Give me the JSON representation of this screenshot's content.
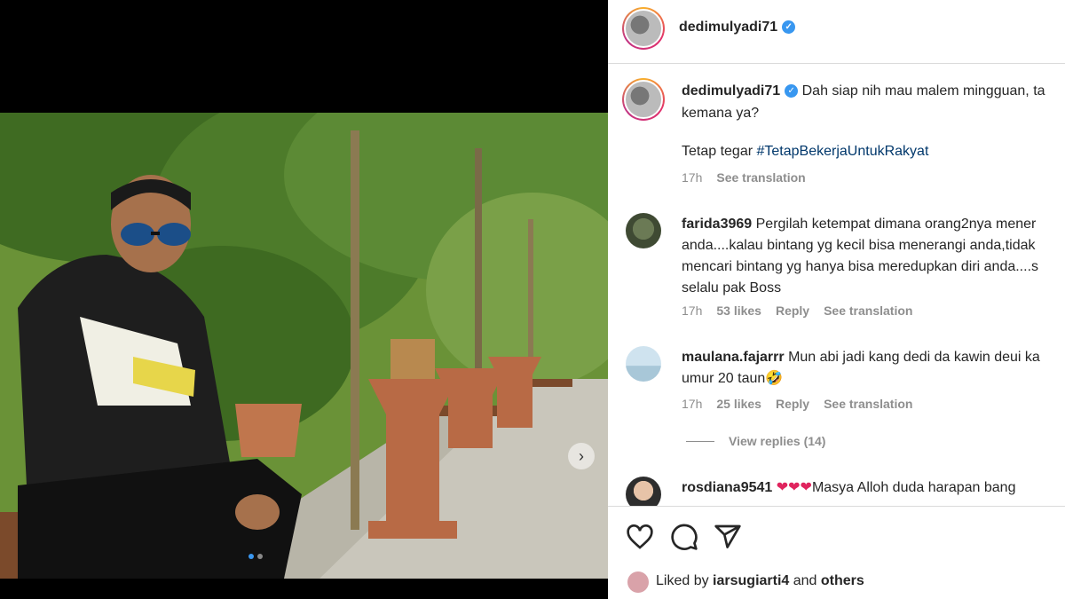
{
  "post": {
    "username": "dedimulyadi71",
    "verified_icon": "verified-badge-icon",
    "caption_line1": "Dah siap nih mau malem mingguan, ta",
    "caption_line2": "kemana ya?",
    "caption_line3": "Tetap tegar ",
    "hashtag": "#TetapBekerjaUntukRakyat",
    "time": "17h",
    "see_translation": "See translation"
  },
  "comments": [
    {
      "username": "farida3969",
      "lines": [
        "Pergilah ketempat dimana orang2nya mener",
        "anda....kalau bintang yg kecil bisa menerangi anda,tidak",
        "mencari bintang yg hanya bisa meredupkan diri anda....s",
        "selalu pak Boss"
      ],
      "time": "17h",
      "likes": "53 likes",
      "reply": "Reply",
      "see_translation": "See translation"
    },
    {
      "username": "maulana.fajarrr",
      "lines": [
        "Mun abi jadi kang dedi da kawin deui ka",
        "umur 20 taun🤣"
      ],
      "time": "17h",
      "likes": "25 likes",
      "reply": "Reply",
      "see_translation": "See translation",
      "view_replies": "View replies (14)"
    },
    {
      "username": "rosdiana9541",
      "hearts": "❤❤❤",
      "lines": [
        "Masya Alloh duda harapan bang"
      ]
    }
  ],
  "actions": {
    "like_icon": "heart-icon",
    "comment_icon": "comment-icon",
    "share_icon": "share-icon"
  },
  "liked_by": {
    "prefix": "Liked by ",
    "user": "iarsugiarti4",
    "middle": " and ",
    "others": "others"
  },
  "carousel": {
    "next_icon": "chevron-right-icon",
    "slide_count": 2,
    "active_index": 0
  },
  "colors": {
    "verified": "#3897f0",
    "hashtag": "#00376b",
    "muted": "#8e8e8e",
    "heart": "#e0245e"
  }
}
